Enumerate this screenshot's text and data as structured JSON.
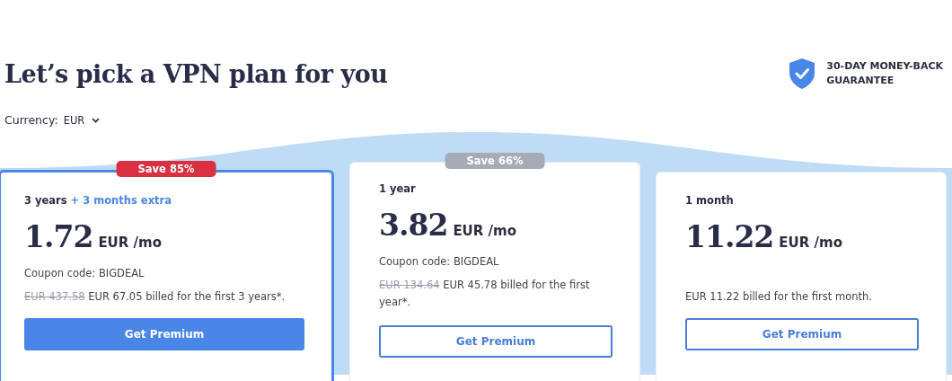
{
  "title": "Let’s pick a VPN plan for you",
  "guarantee": {
    "line_1": "30-DAY MONEY-BACK",
    "line_2": "GUARANTEE"
  },
  "currency": {
    "label": "Currency:",
    "value": "EUR"
  },
  "plans": [
    {
      "selected": true,
      "badge": "Save 85%",
      "duration": "3 years",
      "extra": "+ 3 months extra",
      "price": "1.72",
      "unit": "EUR /mo",
      "coupon": "Coupon code: BIGDEAL",
      "old_price": "EUR 437.58",
      "billing": "EUR 67.05 billed for the first 3 years*.",
      "button": "Get Premium"
    },
    {
      "selected": false,
      "badge": "Save 66%",
      "duration": "1 year",
      "price": "3.82",
      "unit": "EUR /mo",
      "coupon": "Coupon code: BIGDEAL",
      "old_price": "EUR 134.64",
      "billing": "EUR 45.78 billed for the first year*.",
      "button": "Get Premium"
    },
    {
      "selected": false,
      "duration": "1 month",
      "price": "11.22",
      "unit": "EUR /mo",
      "billing": "EUR 11.22 billed for the first month.",
      "button": "Get Premium"
    }
  ]
}
